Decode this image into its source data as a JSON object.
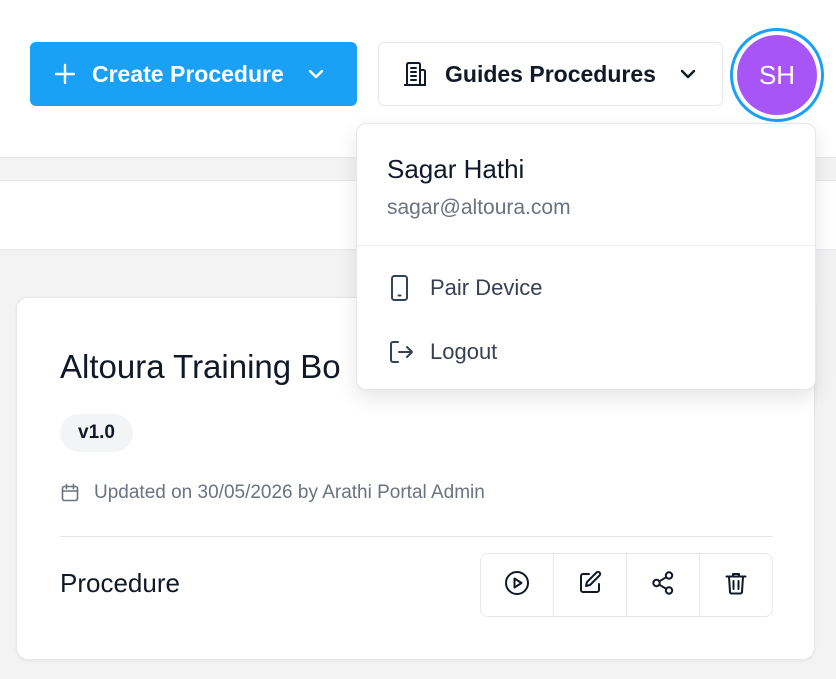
{
  "header": {
    "create_button": {
      "label": "Create Procedure",
      "color": "#1aa0f5"
    },
    "guides_button": {
      "label": "Guides Procedures"
    },
    "avatar": {
      "initials": "SH",
      "color": "#a855f7",
      "ring_color": "#1aa0f5"
    }
  },
  "card": {
    "title": "Altoura Training Bo",
    "version": "v1.0",
    "updated_text": "Updated on 30/05/2026 by Arathi Portal Admin",
    "type_label": "Procedure",
    "actions": [
      {
        "icon": "play-icon"
      },
      {
        "icon": "edit-icon"
      },
      {
        "icon": "share-icon"
      },
      {
        "icon": "trash-icon"
      }
    ]
  },
  "user_menu": {
    "name": "Sagar Hathi",
    "email": "sagar@altoura.com",
    "items": [
      {
        "label": "Pair Device",
        "icon": "phone-icon"
      },
      {
        "label": "Logout",
        "icon": "logout-icon"
      }
    ]
  }
}
